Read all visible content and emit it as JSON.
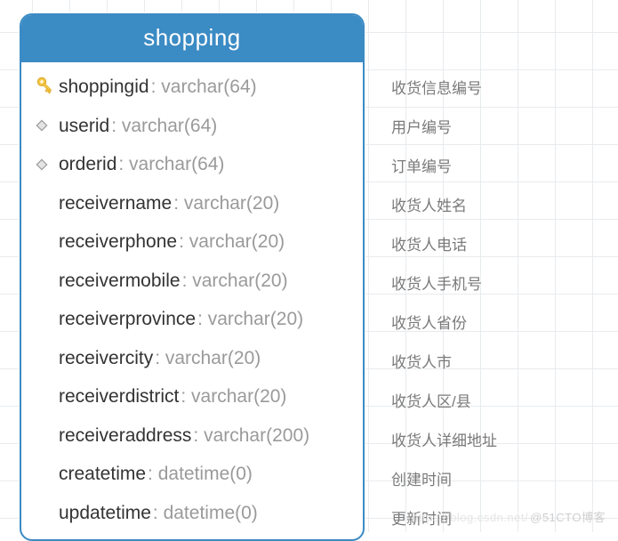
{
  "entity": {
    "title": "shopping",
    "fields": [
      {
        "icon": "key",
        "name": "shoppingid",
        "type": "varchar(64)",
        "label": "收货信息编号"
      },
      {
        "icon": "diamond",
        "name": "userid",
        "type": "varchar(64)",
        "label": "用户编号"
      },
      {
        "icon": "diamond",
        "name": "orderid",
        "type": "varchar(64)",
        "label": "订单编号"
      },
      {
        "icon": "none",
        "name": "receivername",
        "type": "varchar(20)",
        "label": "收货人姓名"
      },
      {
        "icon": "none",
        "name": "receiverphone",
        "type": "varchar(20)",
        "label": "收货人电话"
      },
      {
        "icon": "none",
        "name": "receivermobile",
        "type": "varchar(20)",
        "label": "收货人手机号"
      },
      {
        "icon": "none",
        "name": "receiverprovince",
        "type": "varchar(20)",
        "label": "收货人省份"
      },
      {
        "icon": "none",
        "name": "receivercity",
        "type": "varchar(20)",
        "label": "收货人市"
      },
      {
        "icon": "none",
        "name": "receiverdistrict",
        "type": "varchar(20)",
        "label": "收货人区/县"
      },
      {
        "icon": "none",
        "name": "receiveraddress",
        "type": "varchar(200)",
        "label": "收货人详细地址"
      },
      {
        "icon": "none",
        "name": "createtime",
        "type": "datetime(0)",
        "label": "创建时间"
      },
      {
        "icon": "none",
        "name": "updatetime",
        "type": "datetime(0)",
        "label": "更新时间"
      }
    ]
  },
  "watermark": {
    "left": "https://blog.csdn.net/",
    "right": "@51CTO博客"
  }
}
